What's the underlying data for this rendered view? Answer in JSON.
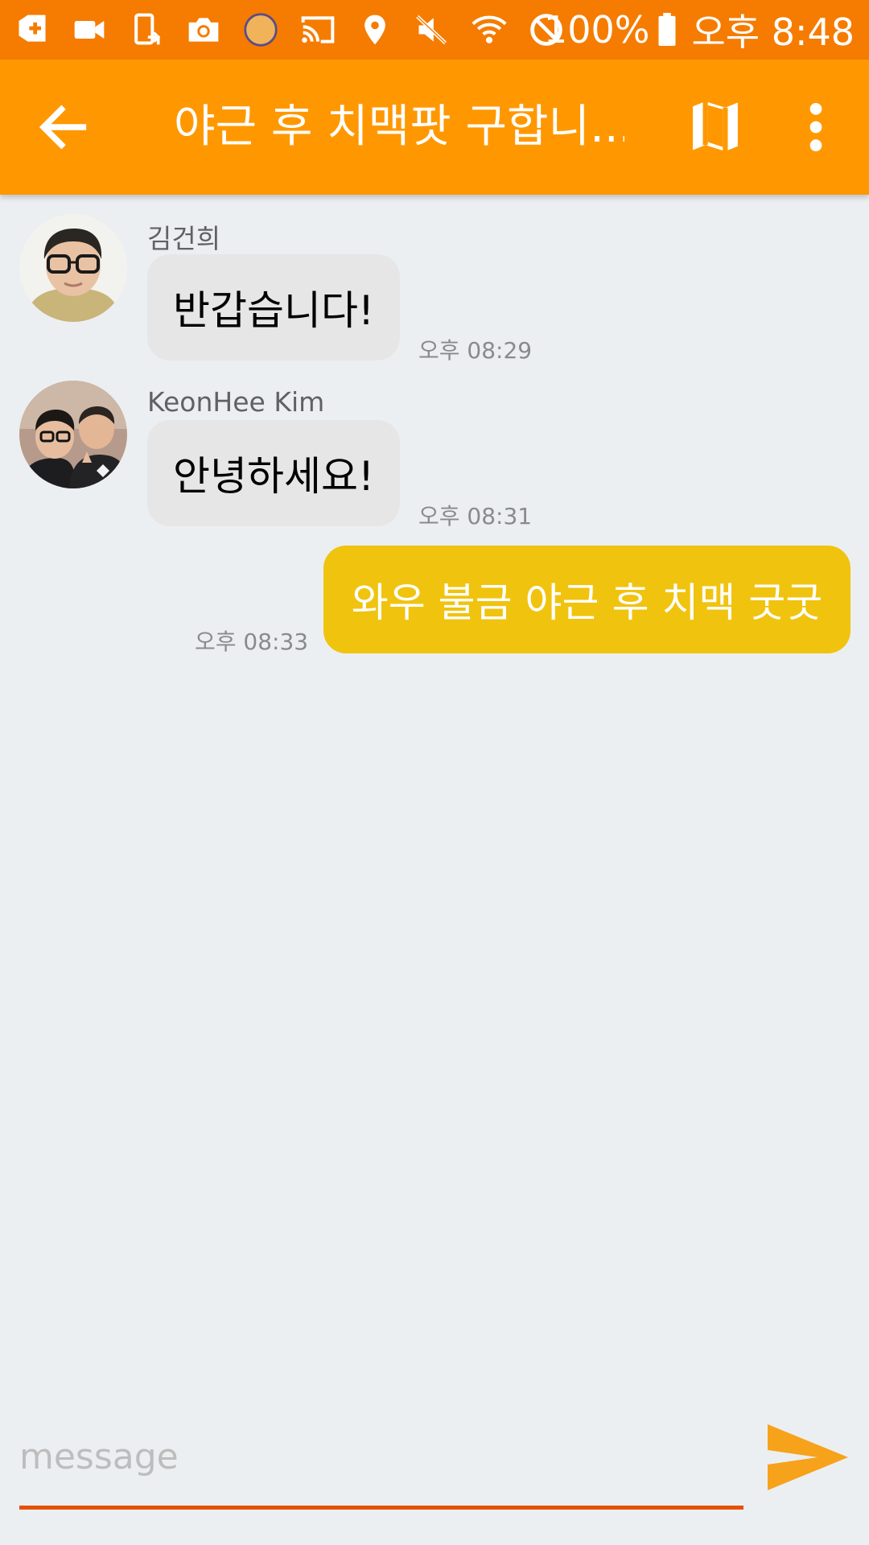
{
  "status_bar": {
    "icons": [
      "add-box-icon",
      "video-camera-icon",
      "screen-rotation-icon",
      "camera-icon",
      "circle-app-icon",
      "cast-icon",
      "location-icon",
      "mute-icon",
      "wifi-icon",
      "block-icon"
    ],
    "battery_percent": "100%",
    "time": "오후 8:48",
    "battery_level": 1.0
  },
  "app_bar": {
    "title": "야근 후 치맥팟 구합니...",
    "background_color": "#ff9800"
  },
  "messages": [
    {
      "sender": "김건희",
      "text": "반갑습니다!",
      "time": "오후 08:29",
      "direction": "incoming",
      "avatar": "avatar-photo-glasses"
    },
    {
      "sender": "KeonHee  Kim",
      "text": "안녕하세요!",
      "time": "오후 08:31",
      "direction": "incoming",
      "avatar": "avatar-photo-two-people"
    },
    {
      "text": "와우 불금 야근 후 치맥 굿굿",
      "time": "오후 08:33",
      "direction": "outgoing"
    }
  ],
  "composer": {
    "placeholder": "message",
    "value": "",
    "accent_color": "#e65100",
    "send_color": "#f7a21b"
  },
  "colors": {
    "status_bar": "#f57c00",
    "background": "#eceff1",
    "incoming_bubble": "#e6e6e6",
    "outgoing_bubble": "#f0c30f"
  }
}
